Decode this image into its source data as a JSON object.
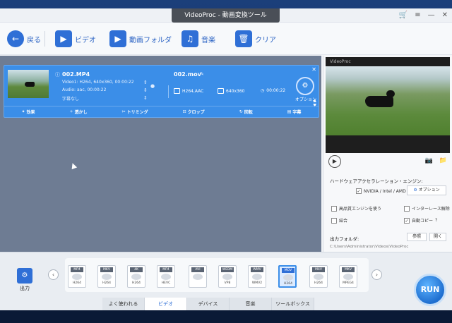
{
  "window": {
    "title": "VideoProc - 動画変換ツール"
  },
  "toolbar": {
    "back_label": "戻る",
    "video_label": "ビデオ",
    "folder_label": "動画フォルダ",
    "music_label": "音楽",
    "clear_label": "クリア"
  },
  "item": {
    "source_name": "002.MP4",
    "video_info": "Video1: H264, 640x360, 00:00:22",
    "audio_info": "Audio: aac, 00:00:22",
    "subtitle_info": "字幕なし",
    "output_name": "002.mov",
    "out_codec": "H264,AAC",
    "out_res": "640x360",
    "out_duration": "00:00:22",
    "codec_label": "オプション",
    "edit_tools": [
      "効果",
      "透かし",
      "トリミング",
      "クロップ",
      "回転",
      "字幕"
    ]
  },
  "preview": {
    "logo": "VideoProc"
  },
  "hardware": {
    "title": "ハードウェアアクセラレーション・エンジン:",
    "nvidia": "NVIDIA / Intel / AMD",
    "option_button": "オプション",
    "high_quality": "高品質エンジンを使う",
    "deinterlace": "インターレース解除",
    "merge": "結合",
    "auto_copy": "自動コピー",
    "output_folder_label": "出力フォルダ:",
    "browse_button": "参照",
    "open_button": "開く",
    "output_path": "C:\\Users\\Administrator\\Videos\\VideoProc"
  },
  "bottom": {
    "output_label": "出力",
    "run_label": "RUN",
    "formats": [
      {
        "ext": "MP4",
        "codec": "H264"
      },
      {
        "ext": "MKV",
        "codec": "H264"
      },
      {
        "ext": "4K",
        "codec": "H264"
      },
      {
        "ext": "MP4",
        "codec": "HEVC"
      },
      {
        "ext": "AVI",
        "codec": ""
      },
      {
        "ext": "WEBM",
        "codec": "VP8"
      },
      {
        "ext": "WMV",
        "codec": "WMV2"
      },
      {
        "ext": "MOV",
        "codec": "H264"
      },
      {
        "ext": "M4V",
        "codec": "H264"
      },
      {
        "ext": "MKV",
        "codec": "MPEG4"
      }
    ],
    "categories": [
      "よく使われる",
      "ビデオ",
      "デバイス",
      "音楽",
      "ツールボックス"
    ],
    "active_category": "ビデオ"
  }
}
